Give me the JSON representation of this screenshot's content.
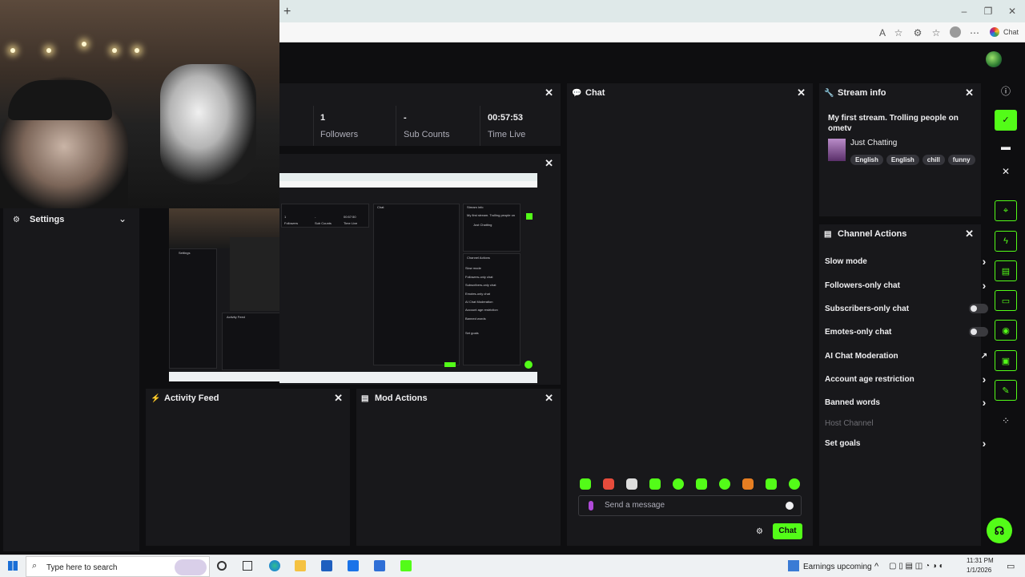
{
  "browser": {
    "new_tab_symbol": "+",
    "chat_label": "Chat"
  },
  "stats": {
    "followers_value": "1",
    "followers_label": "Followers",
    "subs_value": "-",
    "subs_label": "Sub Counts",
    "time_value": "00:57:53",
    "time_label": "Time Live"
  },
  "settings": {
    "label": "Settings"
  },
  "chat": {
    "title": "Chat",
    "placeholder": "Send a message",
    "send_label": "Chat"
  },
  "stream_info": {
    "title": "Stream info",
    "stream_title": "My first stream. Trolling people on ometv",
    "category": "Just Chatting",
    "tags": [
      "English",
      "English",
      "chill",
      "funny"
    ]
  },
  "channel_actions": {
    "title": "Channel Actions",
    "items": [
      {
        "label": "Slow mode",
        "control": "chevron"
      },
      {
        "label": "Followers-only chat",
        "control": "chevron"
      },
      {
        "label": "Subscribers-only chat",
        "control": "toggle"
      },
      {
        "label": "Emotes-only chat",
        "control": "toggle"
      },
      {
        "label": "AI Chat Moderation",
        "control": "external"
      },
      {
        "label": "Account age restriction",
        "control": "chevron"
      },
      {
        "label": "Banned words",
        "control": "chevron"
      },
      {
        "label": "Host Channel",
        "control": "none"
      },
      {
        "label": "Set goals",
        "control": "chevron"
      }
    ]
  },
  "activity_feed": {
    "title": "Activity Feed"
  },
  "mod_actions": {
    "title": "Mod Actions"
  },
  "taskbar": {
    "search_placeholder": "Type here to search",
    "news_label": "Earnings upcoming",
    "time": "11:31 PM",
    "date": "1/1/2026"
  },
  "colors": {
    "accent": "#53fc18",
    "panel": "#18181b",
    "background": "#0e0e10"
  }
}
